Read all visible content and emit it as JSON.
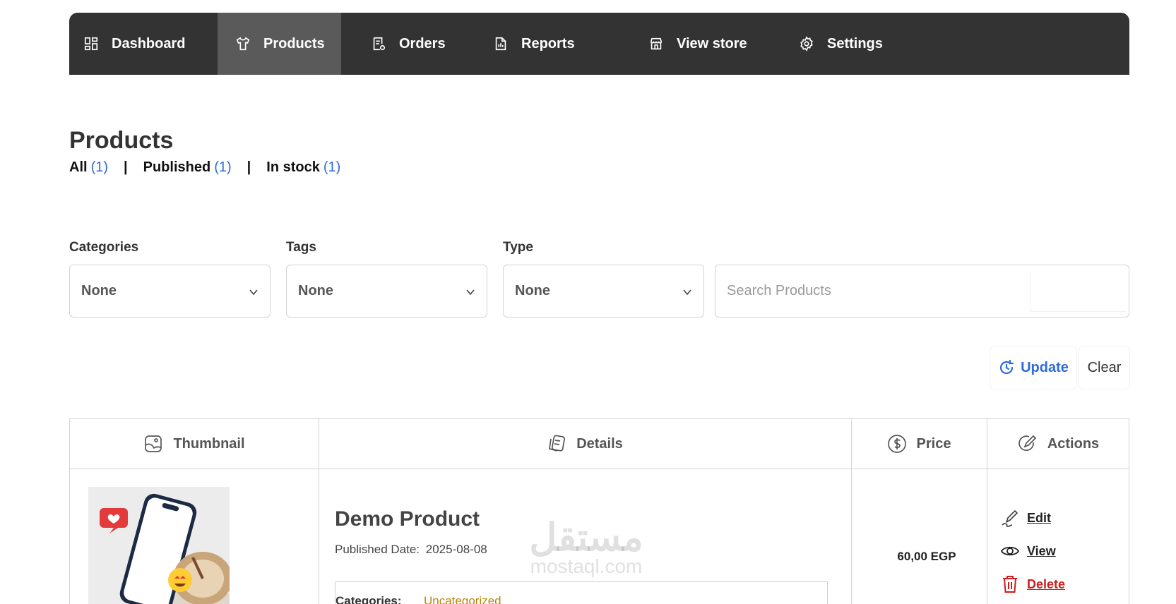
{
  "nav": {
    "items": [
      {
        "label": "Dashboard",
        "icon": "dashboard-icon"
      },
      {
        "label": "Products",
        "icon": "tshirt-icon",
        "active": true
      },
      {
        "label": "Orders",
        "icon": "orders-icon"
      },
      {
        "label": "Reports",
        "icon": "reports-icon"
      },
      {
        "label": "View store",
        "icon": "store-icon"
      },
      {
        "label": "Settings",
        "icon": "gear-icon"
      }
    ]
  },
  "page": {
    "title": "Products",
    "status_filters": [
      {
        "label": "All",
        "count": "(1)"
      },
      {
        "label": "Published",
        "count": "(1)"
      },
      {
        "label": "In stock",
        "count": "(1)"
      }
    ],
    "separator": "|"
  },
  "filters": {
    "categories": {
      "label": "Categories",
      "value": "None"
    },
    "tags": {
      "label": "Tags",
      "value": "None"
    },
    "type": {
      "label": "Type",
      "value": "None"
    },
    "search": {
      "placeholder": "Search Products"
    },
    "update_label": "Update",
    "clear_label": "Clear"
  },
  "table": {
    "headers": {
      "thumbnail": "Thumbnail",
      "details": "Details",
      "price": "Price",
      "actions": "Actions"
    },
    "rows": [
      {
        "title": "Demo Product",
        "published_label": "Published Date:",
        "published_value": "2025-08-08",
        "categories_label": "Categories:",
        "category": "Uncategorized",
        "price": "60,00 EGP",
        "actions": {
          "edit": "Edit",
          "view": "View",
          "delete": "Delete"
        }
      }
    ]
  },
  "watermark": {
    "arabic": "مستقل",
    "latin": "mostaql.com"
  },
  "colors": {
    "nav_bg": "#333333",
    "nav_active": "#5a5a5a",
    "link_blue": "#2f6ad9",
    "delete_red": "#cc1f1f",
    "category_link": "#b8860b"
  }
}
